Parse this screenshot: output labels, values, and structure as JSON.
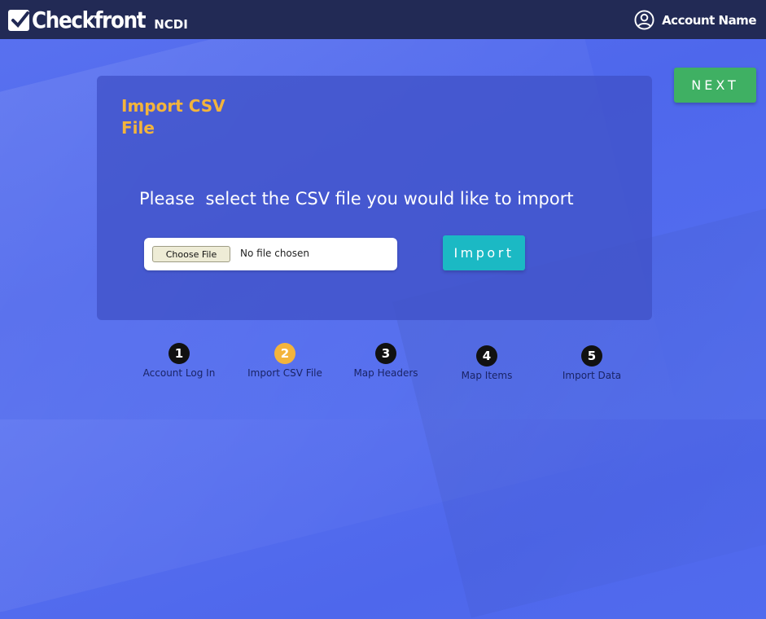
{
  "header": {
    "brand_name": "Checkfront",
    "brand_sub": "NCDI",
    "account_name": "Account Name"
  },
  "actions": {
    "next_label": "NEXT",
    "import_label": "Import"
  },
  "panel": {
    "title": "Import CSV File",
    "prompt": "Please  select the CSV file you would like to import",
    "file_input": {
      "button_label": "Choose File",
      "status": "No file chosen"
    }
  },
  "steps": [
    {
      "number": "1",
      "label": "Account Log In"
    },
    {
      "number": "2",
      "label": "Import CSV File"
    },
    {
      "number": "3",
      "label": "Map Headers"
    },
    {
      "number": "4",
      "label": "Map Items"
    },
    {
      "number": "5",
      "label": "Import Data"
    }
  ],
  "current_step": 2,
  "colors": {
    "topbar": "#222a55",
    "accent_orange": "#f3b43c",
    "next_green": "#3fb063",
    "import_teal": "#1bb9c4"
  }
}
